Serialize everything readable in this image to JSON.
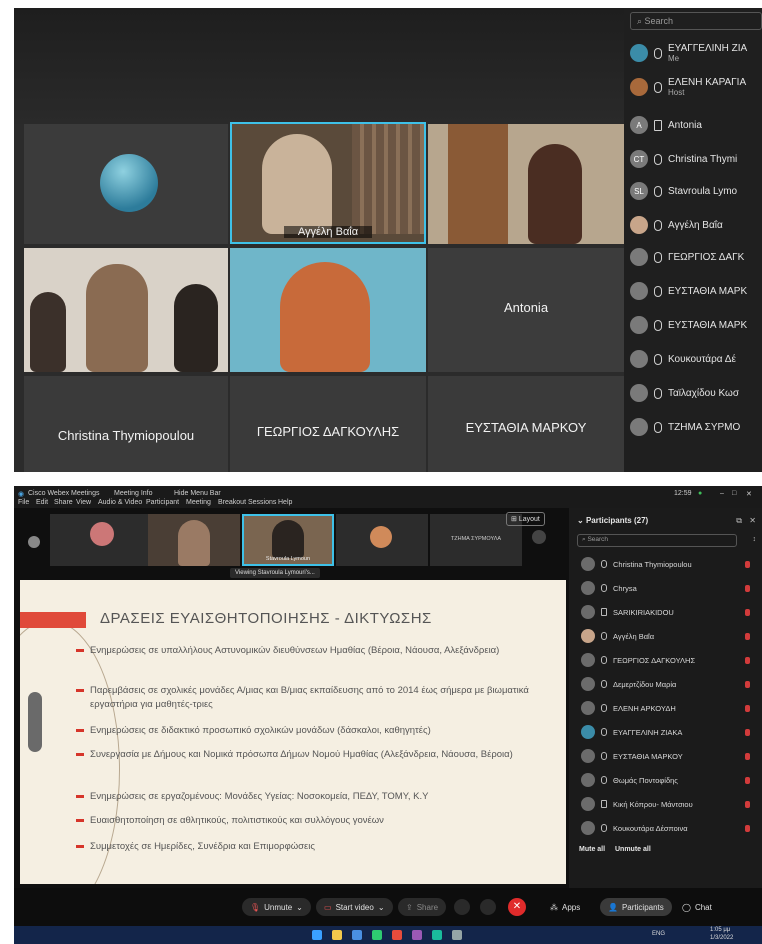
{
  "photo1": {
    "tiles": {
      "t2_name": "Αγγέλη Βαΐα",
      "t6_name": "Antonia",
      "t7_name": "Christina Thymiopoulou",
      "t8_name": "ΓΕΩΡΓΙΟΣ ΔΑΓΚΟΥΛΗΣ",
      "t9_name": "ΕΥΣΤΑΘΙΑ ΜΑΡΚΟΥ"
    },
    "participants": {
      "search_placeholder": "Search",
      "items": [
        {
          "initials": "",
          "name": "ΕΥΑΓΓΕΛΙΝΗ ΖΙΑ",
          "sub": "Me"
        },
        {
          "initials": "",
          "name": "ΕΛΕΝΗ ΚΑΡΑΓΙΑ",
          "sub": "Host"
        },
        {
          "initials": "A",
          "name": "Antonia",
          "sub": ""
        },
        {
          "initials": "CT",
          "name": "Christina Thymi",
          "sub": ""
        },
        {
          "initials": "SL",
          "name": "Stavroula Lymo",
          "sub": ""
        },
        {
          "initials": "",
          "name": "Αγγέλη Βαΐα",
          "sub": ""
        },
        {
          "initials": "",
          "name": "ΓΕΩΡΓΙΟΣ ΔΑΓΚ",
          "sub": ""
        },
        {
          "initials": "",
          "name": "ΕΥΣΤΑΘΙΑ ΜΑΡΚ",
          "sub": ""
        },
        {
          "initials": "",
          "name": "ΕΥΣΤΑΘΙΑ ΜΑΡΚ",
          "sub": ""
        },
        {
          "initials": "",
          "name": "Κουκουτάρα Δέ",
          "sub": ""
        },
        {
          "initials": "",
          "name": "Ταϊλαχίδου Κωσ",
          "sub": ""
        },
        {
          "initials": "",
          "name": "ΤΖΗΜΑ ΣΥΡΜΟ",
          "sub": ""
        }
      ]
    }
  },
  "photo2": {
    "menubar": {
      "app": "Cisco Webex Meetings",
      "meeting_info": "Meeting Info",
      "hide_menu": "Hide Menu Bar",
      "menus": [
        "File",
        "Edit",
        "Share",
        "View",
        "Audio & Video",
        "Participant",
        "Meeting",
        "Breakout Sessions",
        "Help"
      ],
      "clock": "12:59"
    },
    "strip": {
      "thumb3_name": "Stavroula Lymoun",
      "thumb5_name": "ΤΖΗΜΑ ΣΥΡΜΟΥΛΑ",
      "layout_label": "Layout",
      "viewing": "Viewing Stavroula Lymouri's..."
    },
    "slide": {
      "title": "ΔΡΑΣΕΙΣ ΕΥΑΙΣΘΗΤΟΠΟΙΗΣΗΣ - ΔΙΚΤΥΩΣΗΣ",
      "bullets": [
        "Ενημερώσεις σε υπαλλήλους Αστυνομικών διευθύνσεων Ημαθίας (Βέροια, Νάουσα, Αλεξάνδρεια)",
        "Παρεμβάσεις σε σχολικές μονάδες Α/μιας και Β/μιας εκπαίδευσης από το 2014 έως σήμερα με βιωματικά εργαστήρια για μαθητές-τριες",
        "Ενημερώσεις σε διδακτικό προσωπικό σχολικών μονάδων (δάσκαλοι, καθηγητές)",
        "Συνεργασία με Δήμους και Νομικά πρόσωπα Δήμων Νομού Ημαθίας (Αλεξάνδρεια, Νάουσα, Βέροια)",
        "Ενημερώσεις σε εργαζομένους: Μονάδες Υγείας: Νοσοκομεία, ΠΕΔΥ, ΤΟΜΥ, Κ.Υ",
        "Ευαισθητοποίηση σε αθλητικούς, πολιτιστικούς και συλλόγους γονέων",
        "Συμμετοχές σε Ημερίδες, Συνέδρια και Επιμορφώσεις"
      ]
    },
    "participants": {
      "header": "Participants (27)",
      "search_placeholder": "Search",
      "items": [
        "Christina Thymiopoulou",
        "Chrysa",
        "SARIKIRIAKIDOU",
        "Αγγέλη Βαΐα",
        "ΓΕΩΡΓΙΟΣ ΔΑΓΚΟΥΛΗΣ",
        "Δεμερτζίδου Μαρία",
        "ΕΛΕΝΗ ΑΡΚΟΥΔΗ",
        "ΕΥΑΓΓΕΛΙΝΗ ΖΙΑΚΑ",
        "ΕΥΣΤΑΘΙΑ ΜΑΡΚΟΥ",
        "Θωμάς Ποντοφίδης",
        "Κική Κόπρου- Μάντσιου",
        "Κουκουτάρα Δέσποινα"
      ],
      "mute_all": "Mute all",
      "unmute_all": "Unmute all"
    },
    "toolbar": {
      "unmute": "Unmute",
      "start_video": "Start video",
      "share": "Share",
      "apps": "Apps",
      "participants": "Participants",
      "chat": "Chat"
    },
    "taskbar": {
      "lang": "ENG",
      "time": "1:05 μμ",
      "date": "1/3/2022"
    }
  }
}
